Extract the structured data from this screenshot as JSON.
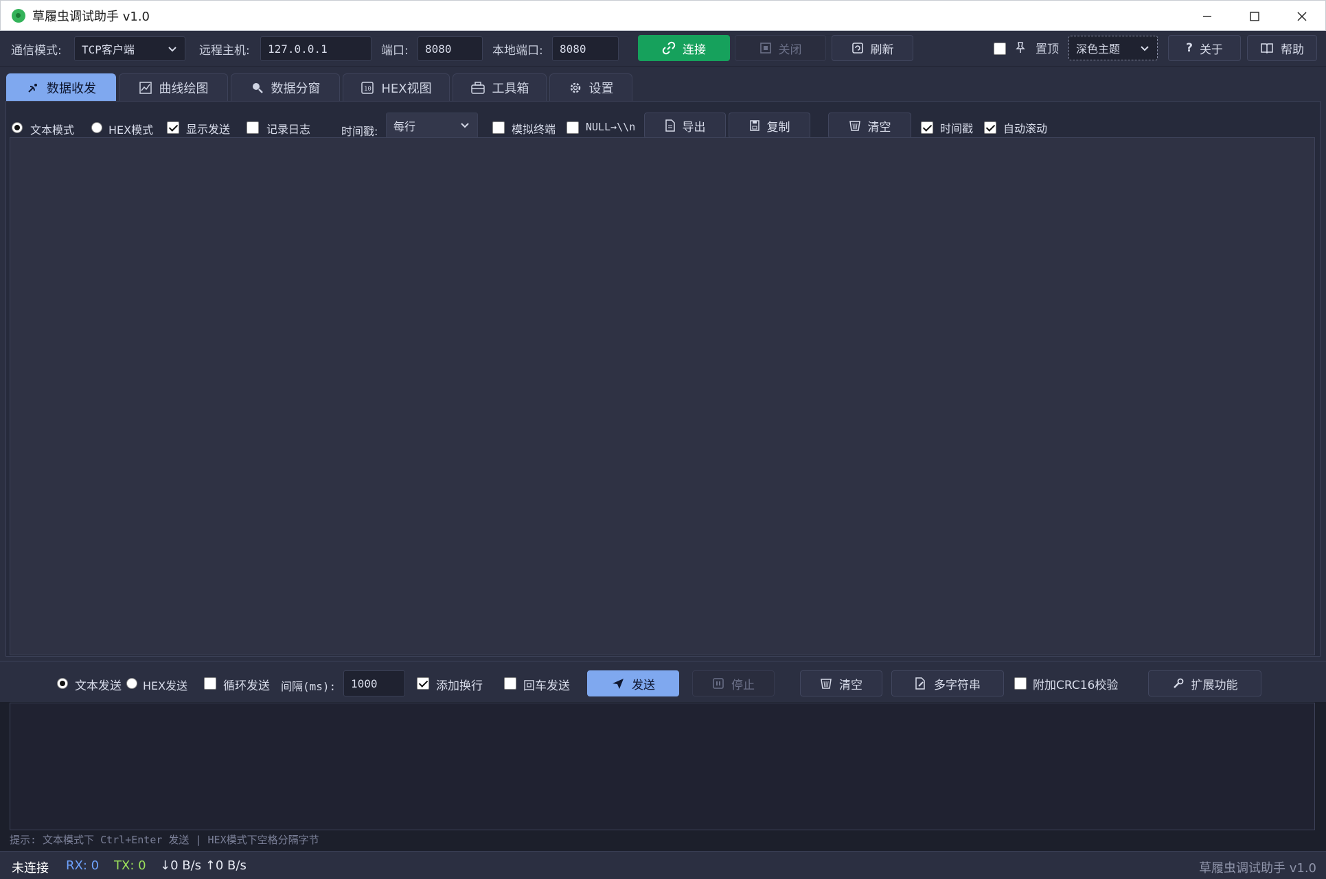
{
  "window": {
    "title": "草履虫调试助手 v1.0"
  },
  "conn": {
    "mode_label": "通信模式:",
    "mode_value": "TCP客户端",
    "host_label": "远程主机:",
    "host_value": "127.0.0.1",
    "port_label": "端口:",
    "port_value": "8080",
    "local_port_label": "本地端口:",
    "local_port_value": "8080",
    "connect": "连接",
    "close": "关闭",
    "refresh": "刷新",
    "pin": "置顶",
    "theme": "深色主题",
    "about": "关于",
    "help": "帮助"
  },
  "tabs": [
    {
      "label": "数据收发",
      "active": true
    },
    {
      "label": "曲线绘图"
    },
    {
      "label": "数据分窗"
    },
    {
      "label": "HEX视图"
    },
    {
      "label": "工具箱"
    },
    {
      "label": "设置"
    }
  ],
  "recv": {
    "text_mode": "文本模式",
    "hex_mode": "HEX模式",
    "show_send": "显示发送",
    "log": "记录日志",
    "ts_label": "时间戳:",
    "ts_value": "每行",
    "terminal": "模拟终端",
    "null_label": "NULL→\\\\n",
    "export": "导出",
    "copy": "复制",
    "clear": "清空",
    "timestamp": "时间戳",
    "autoscroll": "自动滚动"
  },
  "send": {
    "text_send": "文本发送",
    "hex_send": "HEX发送",
    "loop": "循环发送",
    "interval_label": "间隔(ms):",
    "interval_value": "1000",
    "newline": "添加换行",
    "enter_send": "回车发送",
    "send": "发送",
    "stop": "停止",
    "clear": "清空",
    "multi": "多字符串",
    "crc": "附加CRC16校验",
    "ext": "扩展功能",
    "hint": "提示: 文本模式下 Ctrl+Enter 发送 | HEX模式下空格分隔字节"
  },
  "status": {
    "state": "未连接",
    "rx": "RX: 0",
    "tx": "TX: 0",
    "speed": "↓0 B/s ↑0 B/s",
    "app": "草履虫调试助手 v1.0"
  },
  "colors": {
    "accent_blue": "#7fa8ef",
    "connect_green": "#16a15c",
    "rx_color": "#6fa3ff",
    "tx_color": "#9be05a"
  }
}
